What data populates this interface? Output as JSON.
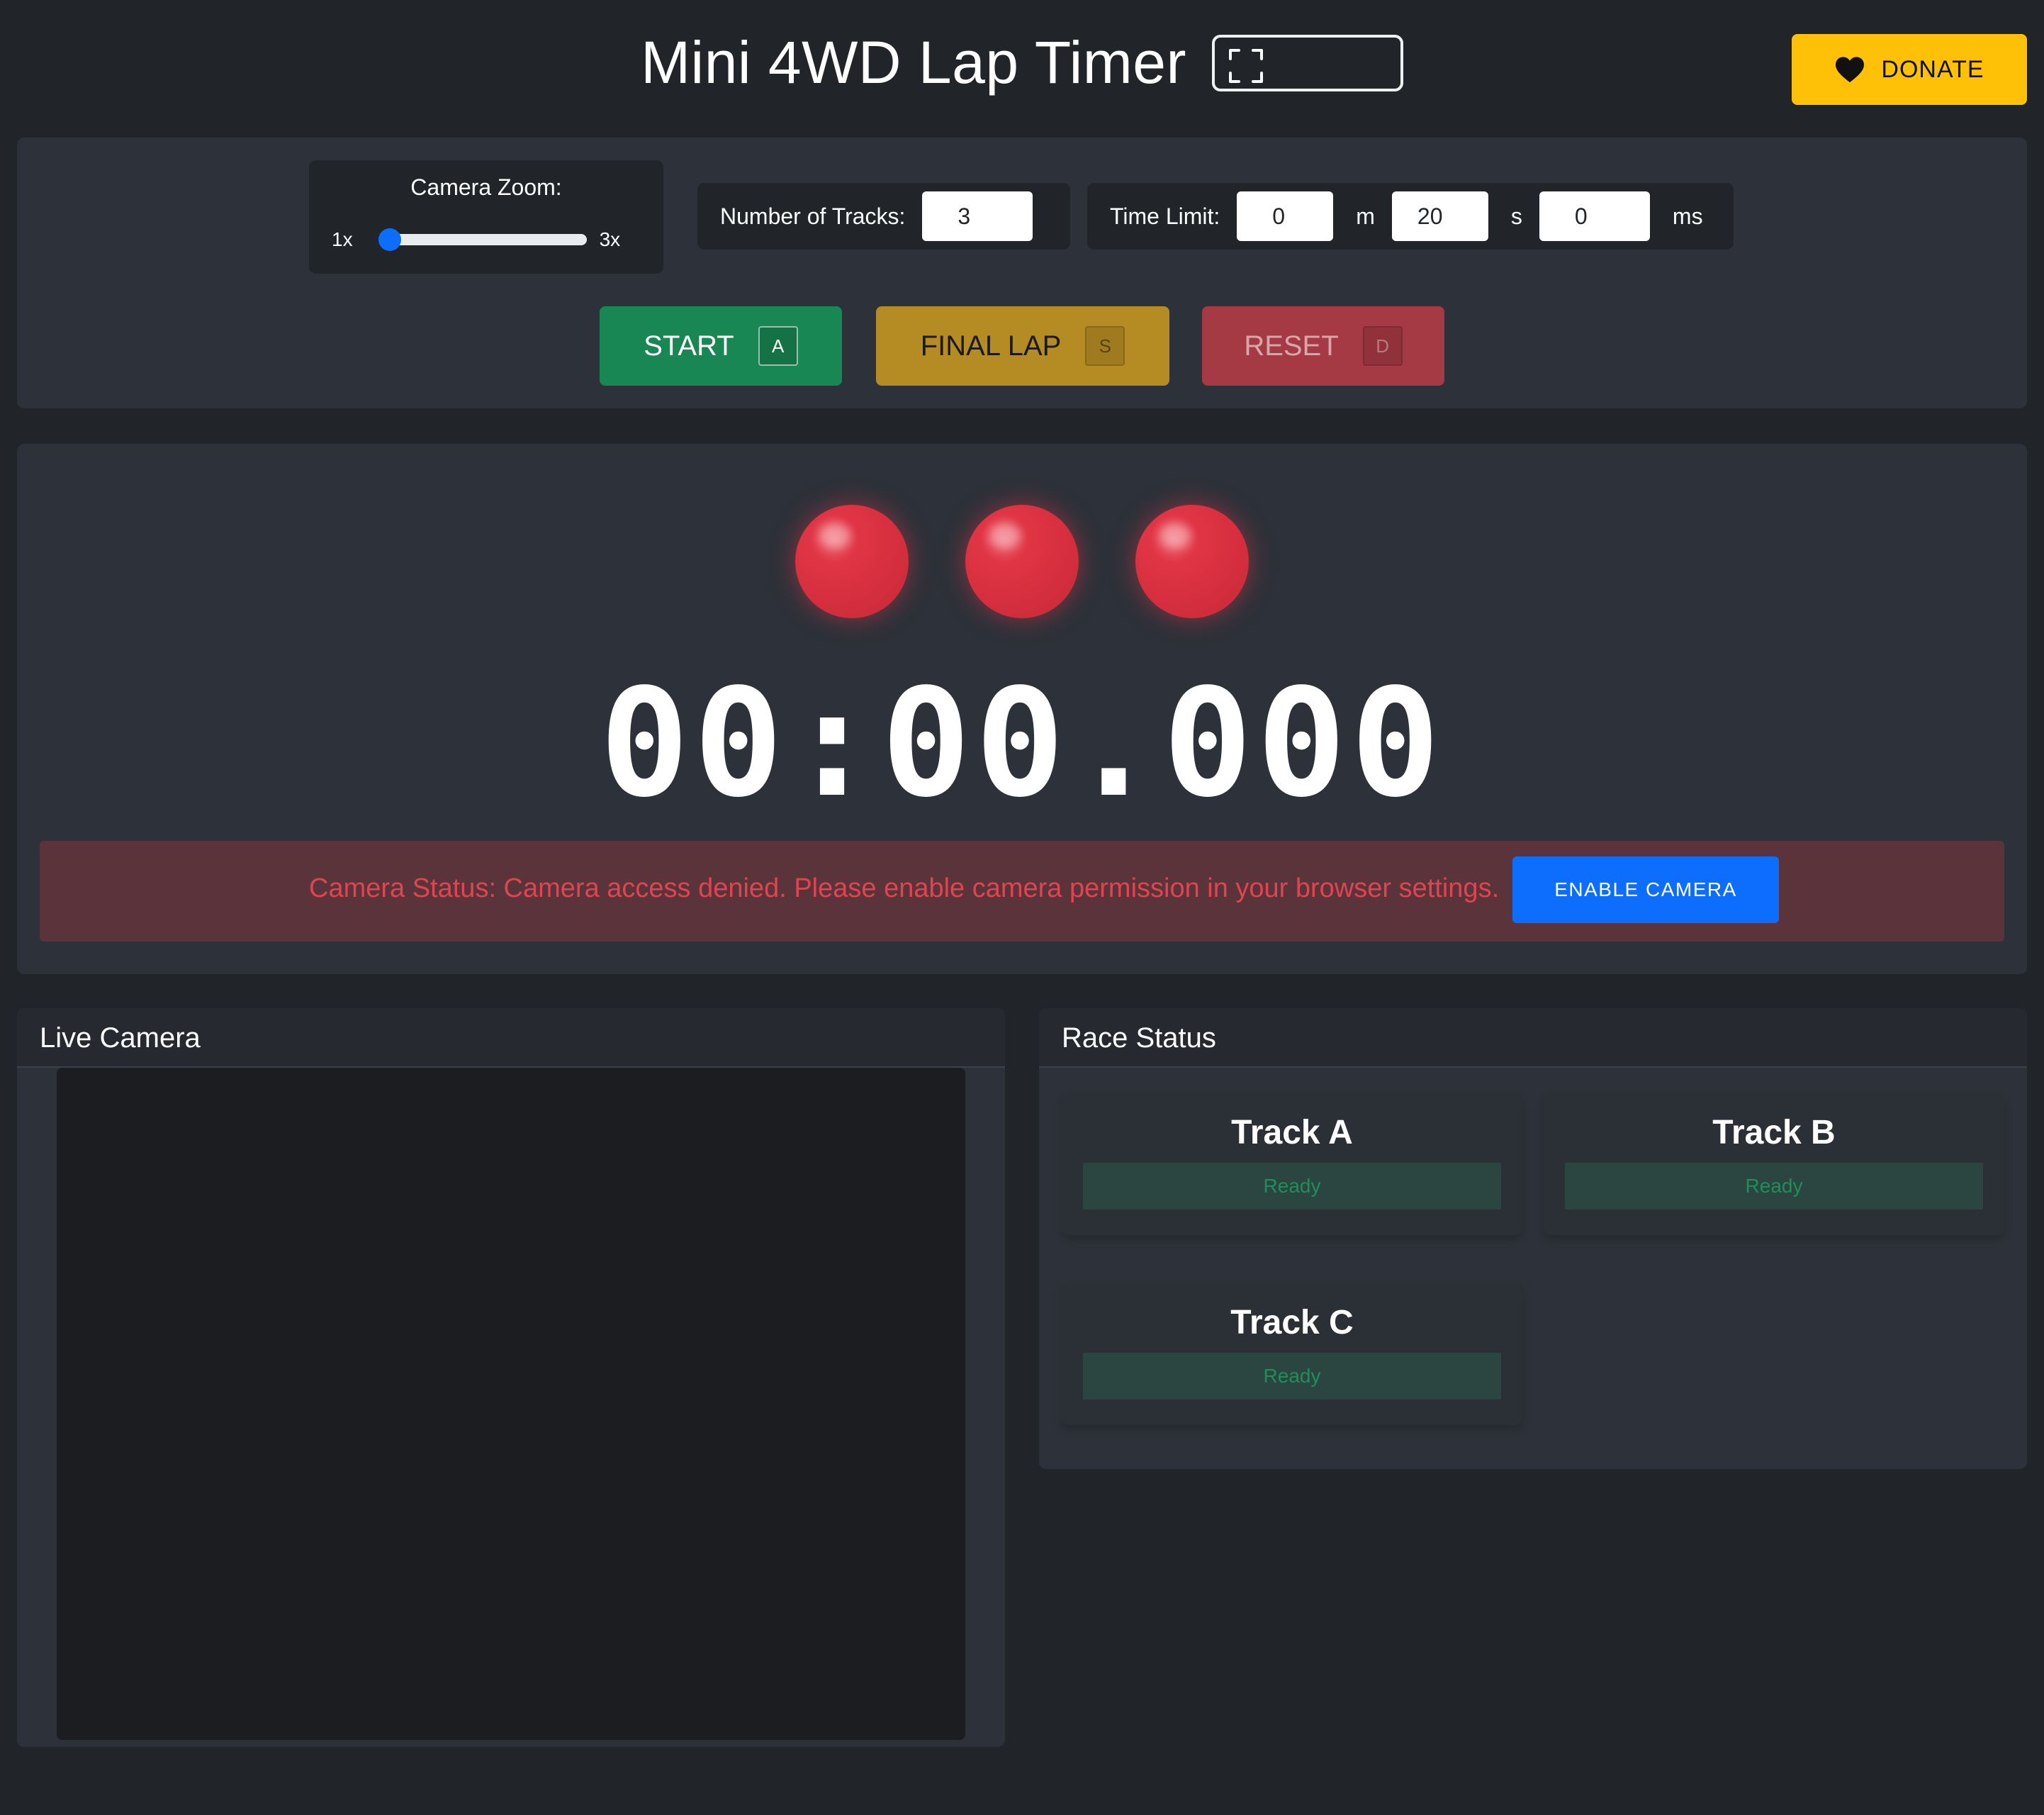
{
  "header": {
    "title": "Mini 4WD Lap Timer",
    "donate_label": "DONATE"
  },
  "controls": {
    "zoom": {
      "label": "Camera Zoom:",
      "min_label": "1x",
      "max_label": "3x",
      "value": 1
    },
    "tracks": {
      "label": "Number of Tracks:",
      "value": "3"
    },
    "time_limit": {
      "label": "Time Limit:",
      "minutes": "0",
      "minutes_unit": "m",
      "seconds": "20",
      "seconds_unit": "s",
      "milliseconds": "0",
      "milliseconds_unit": "ms"
    },
    "buttons": {
      "start": {
        "label": "START",
        "key": "A",
        "color": "#198754"
      },
      "final_lap": {
        "label": "FINAL LAP",
        "key": "S",
        "color": "#b58b23"
      },
      "reset": {
        "label": "RESET",
        "key": "D",
        "color": "#a63a44"
      }
    }
  },
  "timer": {
    "display": "00:00.000",
    "lights": [
      "red",
      "red",
      "red"
    ]
  },
  "camera_status": {
    "message": "Camera Status: Camera access denied. Please enable camera permission in your browser settings.",
    "button_label": "ENABLE CAMERA"
  },
  "live_camera": {
    "title": "Live Camera"
  },
  "race_status": {
    "title": "Race Status",
    "tracks": [
      {
        "name": "Track A",
        "status": "Ready"
      },
      {
        "name": "Track B",
        "status": "Ready"
      },
      {
        "name": "Track C",
        "status": "Ready"
      }
    ]
  },
  "colors": {
    "background": "#212529",
    "panel": "#2d3139",
    "accent": "#0d6efd",
    "donate": "#ffc107",
    "light_red": "#dc3545",
    "ready": "#1f8f5a"
  },
  "icons": {
    "fullscreen": "fullscreen-icon",
    "heart": "heart-icon"
  }
}
